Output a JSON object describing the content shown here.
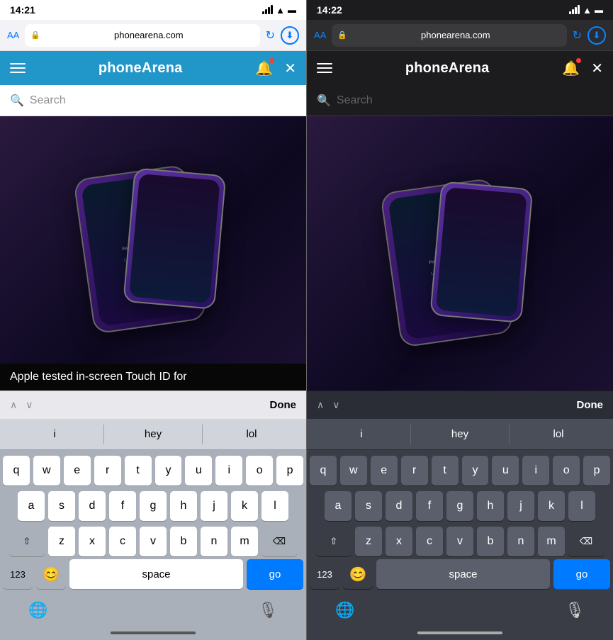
{
  "left": {
    "statusBar": {
      "time": "14:21",
      "theme": "light"
    },
    "urlBar": {
      "aa": "AA",
      "domain": "phonearena.com",
      "downloadIcon": "⬇"
    },
    "siteHeader": {
      "title": "phoneArena",
      "bellIcon": "🔔",
      "closeIcon": "✕"
    },
    "searchBar": {
      "placeholder": "Search"
    },
    "article": {
      "caption": "Apple tested in-screen Touch ID for"
    },
    "findBar": {
      "upArrow": "∧",
      "downArrow": "∨",
      "done": "Done"
    },
    "keyboard": {
      "suggestions": [
        "i",
        "hey",
        "lol"
      ],
      "rows": [
        [
          "q",
          "w",
          "e",
          "r",
          "t",
          "y",
          "u",
          "i",
          "o",
          "p"
        ],
        [
          "a",
          "s",
          "d",
          "f",
          "g",
          "h",
          "j",
          "k",
          "l"
        ],
        [
          "⬆",
          "z",
          "x",
          "c",
          "v",
          "b",
          "n",
          "m",
          "⌫"
        ]
      ],
      "bottom": {
        "num": "123",
        "emojiIcon": "😊",
        "space": "space",
        "go": "go"
      },
      "bottomIcons": {
        "globe": "🌐",
        "mic": "🎙"
      }
    }
  },
  "right": {
    "statusBar": {
      "time": "14:22",
      "theme": "dark"
    },
    "urlBar": {
      "aa": "AA",
      "domain": "phonearena.com",
      "downloadIcon": "⬇"
    },
    "siteHeader": {
      "title": "phoneArena",
      "bellIcon": "🔔",
      "closeIcon": "✕"
    },
    "searchBar": {
      "placeholder": "Search"
    },
    "findBar": {
      "upArrow": "∧",
      "downArrow": "∨",
      "done": "Done"
    },
    "keyboard": {
      "suggestions": [
        "i",
        "hey",
        "lol"
      ],
      "rows": [
        [
          "q",
          "w",
          "e",
          "r",
          "t",
          "y",
          "u",
          "i",
          "o",
          "p"
        ],
        [
          "a",
          "s",
          "d",
          "f",
          "g",
          "h",
          "j",
          "k",
          "l"
        ],
        [
          "⬆",
          "z",
          "x",
          "c",
          "v",
          "b",
          "n",
          "m",
          "⌫"
        ]
      ],
      "bottom": {
        "num": "123",
        "emojiIcon": "😊",
        "space": "space",
        "go": "go"
      },
      "bottomIcons": {
        "globe": "🌐",
        "mic": "🎙"
      }
    }
  }
}
